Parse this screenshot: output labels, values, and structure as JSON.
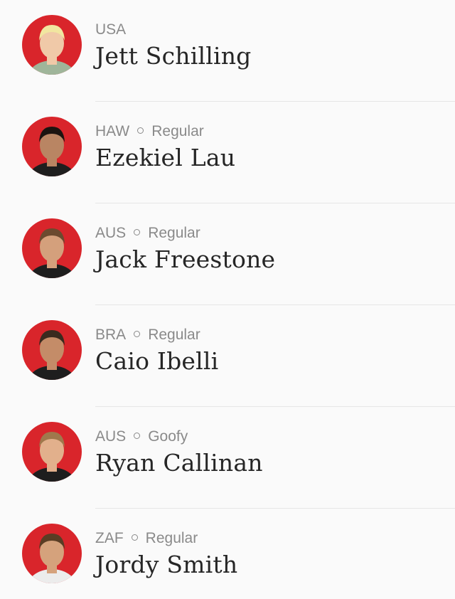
{
  "surfers": [
    {
      "country": "USA",
      "stance": "",
      "name": "Jett Schilling",
      "hair": "#f1e6a0",
      "skin": "#f0c9a8",
      "shirt": "#9fb59a"
    },
    {
      "country": "HAW",
      "stance": "Regular",
      "name": "Ezekiel Lau",
      "hair": "#1c1410",
      "skin": "#b98563",
      "shirt": "#1e1e1e"
    },
    {
      "country": "AUS",
      "stance": "Regular",
      "name": "Jack Freestone",
      "hair": "#6b4a2f",
      "skin": "#d4a07c",
      "shirt": "#1e1e1e"
    },
    {
      "country": "BRA",
      "stance": "Regular",
      "name": "Caio Ibelli",
      "hair": "#3a2a1e",
      "skin": "#c48c68",
      "shirt": "#1e1e1e"
    },
    {
      "country": "AUS",
      "stance": "Goofy",
      "name": "Ryan Callinan",
      "hair": "#a0784c",
      "skin": "#e2b08c",
      "shirt": "#1e1e1e"
    },
    {
      "country": "ZAF",
      "stance": "Regular",
      "name": "Jordy Smith",
      "hair": "#5a3d24",
      "skin": "#d5a27c",
      "shirt": "#ececec"
    }
  ],
  "colors": {
    "avatar_bg": "#d9252b",
    "meta_text": "#8a8a8a",
    "name_text": "#262626",
    "divider": "#e6e6e6",
    "background": "#fafafa"
  }
}
